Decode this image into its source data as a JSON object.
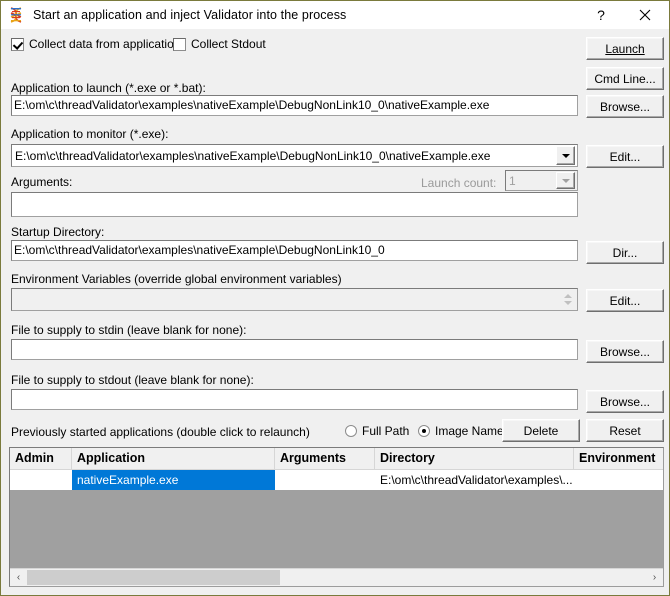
{
  "window": {
    "title": "Start an application and inject Validator into the process",
    "icon": "dna-helix-icon",
    "help_label": "?",
    "close_label": "✕",
    "border_color": "#7a7a3c"
  },
  "options": {
    "collect_data": {
      "label": "Collect data from application",
      "checked": true
    },
    "collect_stdout": {
      "label": "Collect Stdout",
      "checked": false
    }
  },
  "fields": {
    "app_to_launch": {
      "label": "Application to launch (*.exe or *.bat):",
      "value": "E:\\om\\c\\threadValidator\\examples\\nativeExample\\DebugNonLink10_0\\nativeExample.exe",
      "placeholder": ""
    },
    "app_to_monitor": {
      "label": "Application to monitor (*.exe):",
      "value": "E:\\om\\c\\threadValidator\\examples\\nativeExample\\DebugNonLink10_0\\nativeExample.exe",
      "placeholder": ""
    },
    "arguments": {
      "label": "Arguments:",
      "value": "",
      "placeholder": ""
    },
    "launch_count": {
      "label": "Launch count:",
      "value": "1",
      "enabled": false
    },
    "startup_directory": {
      "label": "Startup Directory:",
      "value": "E:\\om\\c\\threadValidator\\examples\\nativeExample\\DebugNonLink10_0",
      "placeholder": ""
    },
    "environment_variables": {
      "label": "Environment Variables (override global environment variables)",
      "value": "",
      "enabled": false
    },
    "stdin_file": {
      "label": "File to supply to stdin (leave blank for none):",
      "value": "",
      "placeholder": ""
    },
    "stdout_file": {
      "label": "File to supply to stdout (leave blank for none):",
      "value": "",
      "placeholder": ""
    }
  },
  "buttons": {
    "launch": "Launch",
    "cmd_line": "Cmd Line...",
    "browse_launch": "Browse...",
    "edit_monitor": "Edit...",
    "dir_startup": "Dir...",
    "edit_environment": "Edit...",
    "browse_stdin": "Browse...",
    "browse_stdout": "Browse...",
    "delete": "Delete",
    "reset": "Reset"
  },
  "history": {
    "label": "Previously started applications (double click to relaunch)",
    "display_mode": {
      "full_path": "Full Path",
      "image_name": "Image Name",
      "selected": "Image Name"
    },
    "columns": [
      "Admin",
      "Application",
      "Arguments",
      "Directory",
      "Environment"
    ],
    "rows": [
      {
        "admin": "",
        "application": "nativeExample.exe",
        "arguments": "",
        "directory": "E:\\om\\c\\threadValidator\\examples\\...",
        "environment": "",
        "selected_cell": "application"
      }
    ],
    "selection_color": "#0078d7"
  },
  "scrollbar": {
    "left_arrow": "‹",
    "right_arrow": "›"
  }
}
